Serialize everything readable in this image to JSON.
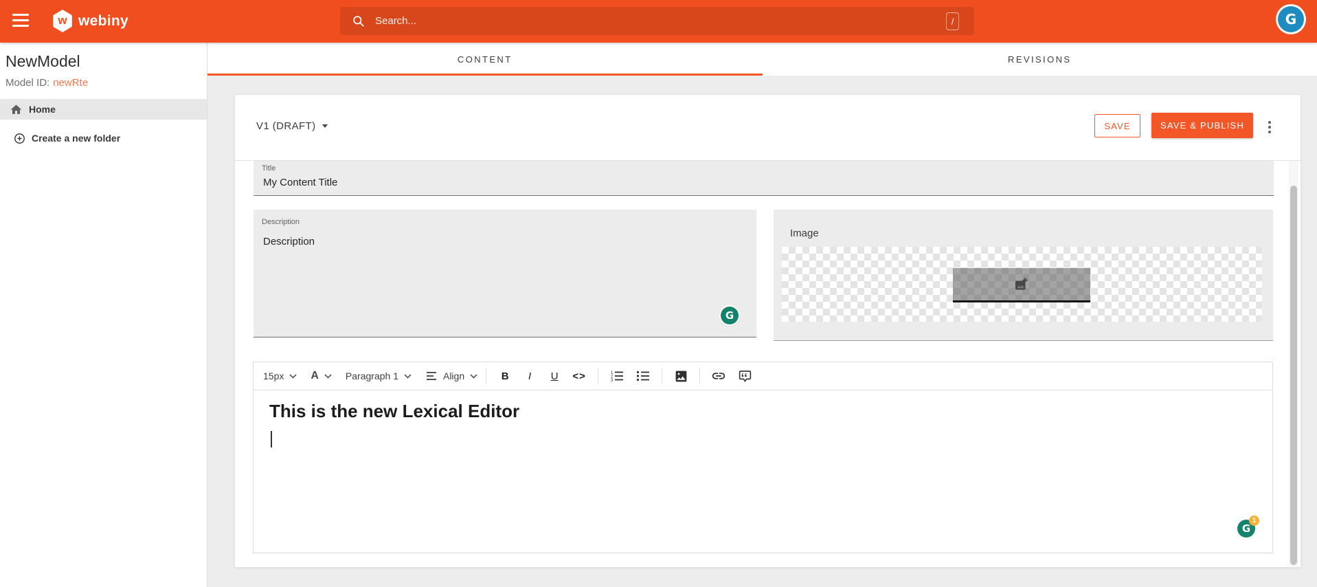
{
  "header": {
    "logo_text": "webiny",
    "logo_letter": "w",
    "avatar_letter": "G",
    "search": {
      "placeholder": "Search...",
      "shortcut_key": "/"
    }
  },
  "sidebar": {
    "model_name": "NewModel",
    "model_id_label": "Model ID:",
    "model_id_value": "newRte",
    "home_label": "Home",
    "create_folder_label": "Create a new folder"
  },
  "tabs": {
    "content": "CONTENT",
    "revisions": "REVISIONS"
  },
  "card": {
    "version_label": "V1 (DRAFT)",
    "save_label": "SAVE",
    "save_publish_label": "SAVE & PUBLISH"
  },
  "fields": {
    "title": {
      "label": "Title",
      "value": "My Content Title"
    },
    "description": {
      "label": "Description",
      "value": "Description"
    },
    "image": {
      "label": "Image"
    }
  },
  "rte": {
    "font_size": "15px",
    "font_color": "A",
    "block_type": "Paragraph 1",
    "align": "Align",
    "bold": "B",
    "italic": "I",
    "underline": "U",
    "code": "<>",
    "heading": "This is the new Lexical Editor"
  },
  "grammarly": {
    "letter": "G",
    "badge": "1"
  },
  "colors": {
    "brand_orange": "#F04E1E",
    "button_orange": "#F35627",
    "model_id_orange": "#F4794F",
    "gravatar_blue": "#1E8CBE",
    "grammarly_green": "#15836B",
    "badge_yellow": "#F2B23C"
  }
}
